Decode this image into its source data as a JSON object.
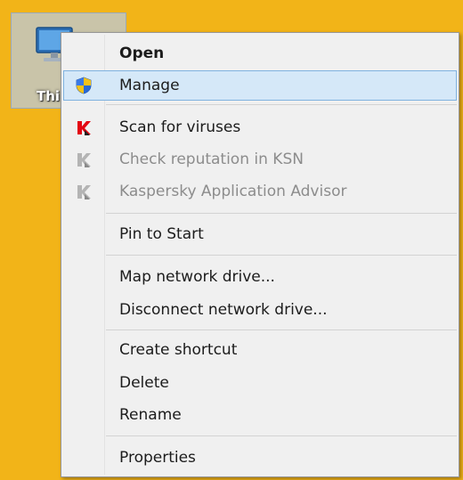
{
  "desktop": {
    "background_color": "#f2b418",
    "icon_label": "Thi"
  },
  "menu": {
    "items": [
      {
        "label": "Open",
        "bold": true,
        "icon": null
      },
      {
        "label": "Manage",
        "highlighted": true,
        "icon": "uac-shield-icon"
      },
      {
        "label": "Scan for viruses",
        "icon": "kaspersky-k-icon"
      },
      {
        "label": "Check reputation in KSN",
        "disabled": true,
        "icon": "kaspersky-k-gray-icon"
      },
      {
        "label": "Kaspersky Application Advisor",
        "disabled": true,
        "icon": "kaspersky-k-gray-icon"
      },
      {
        "label": "Pin to Start",
        "icon": null
      },
      {
        "label": "Map network drive...",
        "icon": null
      },
      {
        "label": "Disconnect network drive...",
        "icon": null
      },
      {
        "label": "Create shortcut",
        "icon": null
      },
      {
        "label": "Delete",
        "icon": null
      },
      {
        "label": "Rename",
        "icon": null
      },
      {
        "label": "Properties",
        "icon": null
      }
    ]
  },
  "colors": {
    "highlight_bg": "#d5e8f8",
    "highlight_border": "#7fb2e0",
    "kaspersky_red": "#e30613"
  }
}
